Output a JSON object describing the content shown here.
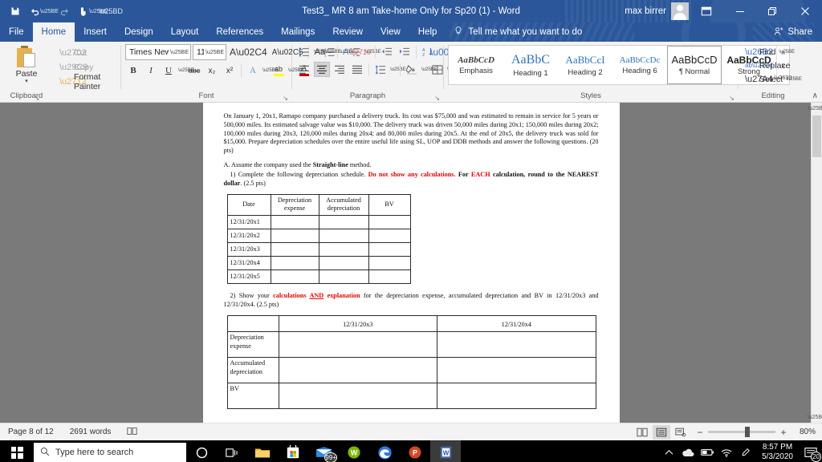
{
  "titlebar": {
    "quick_access": [
      {
        "name": "save",
        "glyph": "💾"
      },
      {
        "name": "undo",
        "glyph": "↶"
      },
      {
        "name": "redo",
        "glyph": "↻"
      },
      {
        "name": "touch-mode",
        "glyph": "☝"
      },
      {
        "name": "customize-quick-access-toolbar",
        "glyph": "▽"
      }
    ],
    "title": "Test3_ MR 8 am Take-home Only for Sp20 (1)  -  Word",
    "account_name": "max birrer",
    "ribbon_display_options": "⌧",
    "minimize": "—",
    "restore": "❐",
    "close": "✕"
  },
  "tabs": [
    {
      "label": "File",
      "active": false
    },
    {
      "label": "Home",
      "active": true
    },
    {
      "label": "Insert",
      "active": false
    },
    {
      "label": "Design",
      "active": false
    },
    {
      "label": "Layout",
      "active": false
    },
    {
      "label": "References",
      "active": false
    },
    {
      "label": "Mailings",
      "active": false
    },
    {
      "label": "Review",
      "active": false
    },
    {
      "label": "View",
      "active": false
    },
    {
      "label": "Help",
      "active": false
    }
  ],
  "tellme": {
    "icon": "💡",
    "label": "Tell me what you want to do"
  },
  "share": {
    "icon": "☺",
    "label": "Share"
  },
  "ribbon": {
    "clipboard": {
      "group_label": "Clipboard",
      "paste_label": "Paste",
      "paste_caret": "▾",
      "cut_label": "Cut",
      "copy_label": "Copy",
      "format_painter_label": "Format Painter",
      "launcher": "↘"
    },
    "font": {
      "group_label": "Font",
      "font_name": "Times New R",
      "font_size": "11",
      "grow_font": "A",
      "shrink_font": "A",
      "change_case": "Aa",
      "clear_formatting": "A",
      "bold": "B",
      "italic": "I",
      "underline": "U",
      "strikethrough": "abc",
      "subscript": "x₂",
      "superscript": "x²",
      "text_effects": "A",
      "highlight": "ab",
      "font_color": "A",
      "caret": "▾",
      "launcher": "↘"
    },
    "paragraph": {
      "group_label": "Paragraph",
      "bullets": "☷",
      "numbering": "☰",
      "multilevel_list": "☲",
      "decrease_indent": "⇤",
      "increase_indent": "⇥",
      "sort": "A↓",
      "show_marks": "¶",
      "align_left": "≡",
      "align_center": "≡",
      "align_right": "≡",
      "justify": "≡",
      "line_spacing": "↕",
      "shading": "▤",
      "borders": "⊞",
      "caret": "▾",
      "launcher": "↘"
    },
    "styles": {
      "group_label": "Styles",
      "items": [
        {
          "preview": "AaBbCcD",
          "name": "Emphasis",
          "selected": false
        },
        {
          "preview": "AaBbC",
          "name": "Heading 1",
          "selected": false
        },
        {
          "preview": "AaBbCcI",
          "name": "Heading 2",
          "selected": false
        },
        {
          "preview": "AaBbCcDc",
          "name": "Heading 6",
          "selected": false
        },
        {
          "preview": "AaBbCcD",
          "name": "¶ Normal",
          "selected": true
        },
        {
          "preview": "AaBbCcD",
          "name": "Strong",
          "selected": false
        }
      ],
      "scroll_up": "∧",
      "scroll_down": "∨",
      "more": "⩛",
      "launcher": "↘"
    },
    "editing": {
      "group_label": "Editing",
      "find_label": "Find",
      "find_icon": "🔍",
      "find_caret": "▾",
      "replace_label": "Replace",
      "replace_icon": "ab",
      "select_label": "Select",
      "select_icon": "↖",
      "select_caret": "▾"
    },
    "collapse_ribbon": "∧"
  },
  "document": {
    "paragraph1": "On January 1, 20x1, Ramapo company purchased a delivery truck. Its cost was $75,000 and was estimated to remain in service for 5 years or 500,000 miles. Its estimated salvage value was $10,000. The delivery truck was driven 50,000 miles during 20x1; 150,000 miles during 20x2; 100,000 miles during 20x3, 120,000 miles during 20x4; and 80,000 miles during 20x5. At the end of 20x5, the delivery truck was sold for $15,000. Prepare depreciation schedules over the entire useful life using SL, UOP and DDB methods and answer the following questions. (20 pts)",
    "section_a_prefix": "A. Assume the company used the ",
    "section_a_bold": "Straight-line",
    "section_a_suffix": " method.",
    "q1_prefix": "1) Complete the following depreciation schedule. ",
    "q1_red1": "Do not show any calculations.",
    "q1_mid": " For ",
    "q1_red2": "EACH",
    "q1_bold_tail": " calculation, round to the NEAREST dollar",
    "q1_tail": ". (2.5 pts)",
    "q2_prefix": "2) Show your ",
    "q2_red_a": "calculations ",
    "q2_red_and": "AND",
    "q2_red_b": " explanation",
    "q2_suffix": " for the depreciation expense, accumulated depreciation and BV in 12/31/20x3 and 12/31/20x4. (2.5 pts)",
    "table1": {
      "headers": [
        "Date",
        "Depreciation expense",
        "Accumulated depreciation",
        "BV"
      ],
      "rows": [
        [
          "12/31/20x1",
          "",
          "",
          ""
        ],
        [
          "12/31/20x2",
          "",
          "",
          ""
        ],
        [
          "12/31/20x3",
          "",
          "",
          ""
        ],
        [
          "12/31/20x4",
          "",
          "",
          ""
        ],
        [
          "12/31/20x5",
          "",
          "",
          ""
        ]
      ]
    },
    "table2": {
      "headers": [
        "",
        "12/31/20x3",
        "12/31/20x4"
      ],
      "rows": [
        [
          "Depreciation expense",
          "",
          ""
        ],
        [
          "Accumulated depreciation",
          "",
          ""
        ],
        [
          "BV",
          "",
          ""
        ]
      ]
    }
  },
  "statusbar": {
    "page": "Page 8 of 12",
    "words": "2691 words",
    "proofing_icon": "📖",
    "view_read": "▤",
    "view_print": "▤",
    "view_web": "▤",
    "zoom_out": "−",
    "zoom_in": "+",
    "zoom_level": "80%"
  },
  "taskbar": {
    "search_placeholder": "Type here to search",
    "search_icon": "🔍",
    "cortana_icon": "◯",
    "taskview_icon": "▣",
    "apps": [
      {
        "name": "file-explorer",
        "label": "📁"
      },
      {
        "name": "microsoft-store",
        "label": "🛒"
      },
      {
        "name": "mail",
        "label": "✉",
        "badge": "99+"
      },
      {
        "name": "webex",
        "label": "W"
      },
      {
        "name": "microsoft-edge",
        "label": "e"
      },
      {
        "name": "powerpoint",
        "label": "P"
      },
      {
        "name": "word",
        "label": "W"
      }
    ],
    "tray": [
      {
        "name": "show-hidden-icons",
        "glyph": "∧"
      },
      {
        "name": "onedrive",
        "glyph": "☁"
      },
      {
        "name": "battery",
        "glyph": "▭"
      },
      {
        "name": "wifi",
        "glyph": "◠"
      },
      {
        "name": "pen-touch",
        "glyph": "✎"
      }
    ],
    "clock_time": "8:57 PM",
    "clock_date": "5/3/2020",
    "notification_badge": "20"
  },
  "colors": {
    "word_blue": "#2b579a",
    "accent_red": "#e00000",
    "taskbar": "#000000"
  }
}
